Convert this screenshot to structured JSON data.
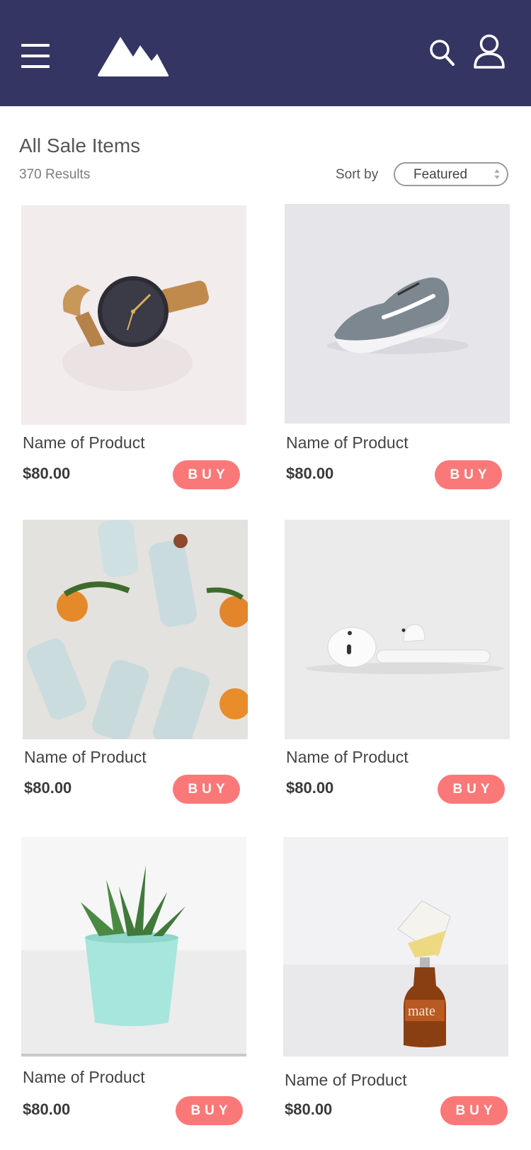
{
  "header": {
    "menu_icon": "hamburger-menu-icon",
    "logo_icon": "mountain-logo-icon",
    "search_icon": "search-icon",
    "profile_icon": "user-profile-icon",
    "background_color": "#343562"
  },
  "listing": {
    "title": "All Sale Items",
    "results_count": "370 Results",
    "sort_label": "Sort by",
    "sort_value": "Featured"
  },
  "products": [
    {
      "name": "Name of Product",
      "price": "$80.00",
      "buy_label": "BUY",
      "image": "wristwatch-photo"
    },
    {
      "name": "Name of Product",
      "price": "$80.00",
      "buy_label": "BUY",
      "image": "sneaker-photo"
    },
    {
      "name": "Name of Product",
      "price": "$80.00",
      "buy_label": "BUY",
      "image": "water-bottles-oranges-photo"
    },
    {
      "name": "Name of Product",
      "price": "$80.00",
      "buy_label": "BUY",
      "image": "earbuds-photo"
    },
    {
      "name": "Name of Product",
      "price": "$80.00",
      "buy_label": "BUY",
      "image": "succulent-plant-photo"
    },
    {
      "name": "Name of Product",
      "price": "$80.00",
      "buy_label": "BUY",
      "image": "mate-bottle-glass-photo"
    }
  ],
  "colors": {
    "accent": "#fb7878",
    "header": "#343562"
  }
}
